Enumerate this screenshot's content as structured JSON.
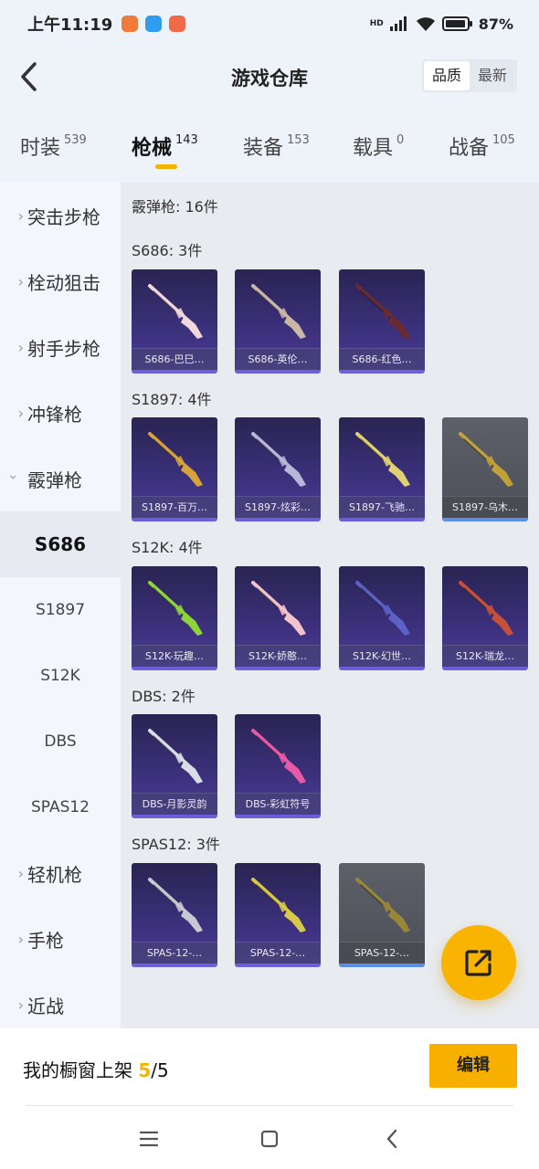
{
  "status_bar": {
    "time": "上午11:19",
    "network": "HD",
    "battery": "87%"
  },
  "header": {
    "title": "游戏仓库",
    "sort_quality": "品质",
    "sort_latest": "最新"
  },
  "tabs": [
    {
      "label": "时装",
      "count": "539"
    },
    {
      "label": "枪械",
      "count": "143"
    },
    {
      "label": "装备",
      "count": "153"
    },
    {
      "label": "载具",
      "count": "0"
    },
    {
      "label": "战备",
      "count": "105"
    }
  ],
  "sidebar": [
    {
      "label": "突击步枪"
    },
    {
      "label": "栓动狙击"
    },
    {
      "label": "射手步枪"
    },
    {
      "label": "冲锋枪"
    },
    {
      "label": "霰弹枪"
    },
    {
      "label": "S686"
    },
    {
      "label": "S1897"
    },
    {
      "label": "S12K"
    },
    {
      "label": "DBS"
    },
    {
      "label": "SPAS12"
    },
    {
      "label": "轻机枪"
    },
    {
      "label": "手枪"
    },
    {
      "label": "近战"
    }
  ],
  "main": {
    "category_title": "霰弹枪: 16件",
    "groups": [
      {
        "title": "S686: 3件",
        "items": [
          {
            "name": "S686-巴巳…",
            "rarity": "purple",
            "gun_color": "#f0d8dc"
          },
          {
            "name": "S686-英伦…",
            "rarity": "purple",
            "gun_color": "#c9b7a8"
          },
          {
            "name": "S686-红色…",
            "rarity": "purple",
            "gun_color": "#6b2a30"
          }
        ]
      },
      {
        "title": "S1897: 4件",
        "items": [
          {
            "name": "S1897-百万…",
            "rarity": "purple",
            "gun_color": "#d6a23c"
          },
          {
            "name": "S1897-炫彩…",
            "rarity": "purple",
            "gun_color": "#b8b7d8"
          },
          {
            "name": "S1897-飞驰…",
            "rarity": "purple",
            "gun_color": "#e2d070"
          },
          {
            "name": "S1897-乌木…",
            "rarity": "gray",
            "gun_color": "#c2a238"
          }
        ]
      },
      {
        "title": "S12K: 4件",
        "items": [
          {
            "name": "S12K-玩趣…",
            "rarity": "purple",
            "gun_color": "#8fd43a"
          },
          {
            "name": "S12K-娇憨…",
            "rarity": "purple",
            "gun_color": "#f4c2cc"
          },
          {
            "name": "S12K-幻世…",
            "rarity": "purple",
            "gun_color": "#5a62c8"
          },
          {
            "name": "S12K-瑞龙…",
            "rarity": "purple",
            "gun_color": "#c8503a"
          }
        ]
      },
      {
        "title": "DBS: 2件",
        "items": [
          {
            "name": "DBS-月影灵韵",
            "rarity": "purple",
            "gun_color": "#d8dde8"
          },
          {
            "name": "DBS-彩虹符号",
            "rarity": "purple",
            "gun_color": "#e85aa8"
          }
        ]
      },
      {
        "title": "SPAS12: 3件",
        "items": [
          {
            "name": "SPAS-12-…",
            "rarity": "purple",
            "gun_color": "#c8c8d4"
          },
          {
            "name": "SPAS-12-…",
            "rarity": "purple",
            "gun_color": "#d8c84a"
          },
          {
            "name": "SPAS-12-…",
            "rarity": "gray",
            "gun_color": "#9a8638"
          }
        ]
      }
    ]
  },
  "shelf": {
    "label": "我的橱窗上架",
    "current": "5",
    "total": "/5",
    "edit_label": "编辑"
  },
  "colors": {
    "accent": "#f5b200",
    "purple_card": "#3a2f78",
    "gray_card": "#4d5058"
  }
}
